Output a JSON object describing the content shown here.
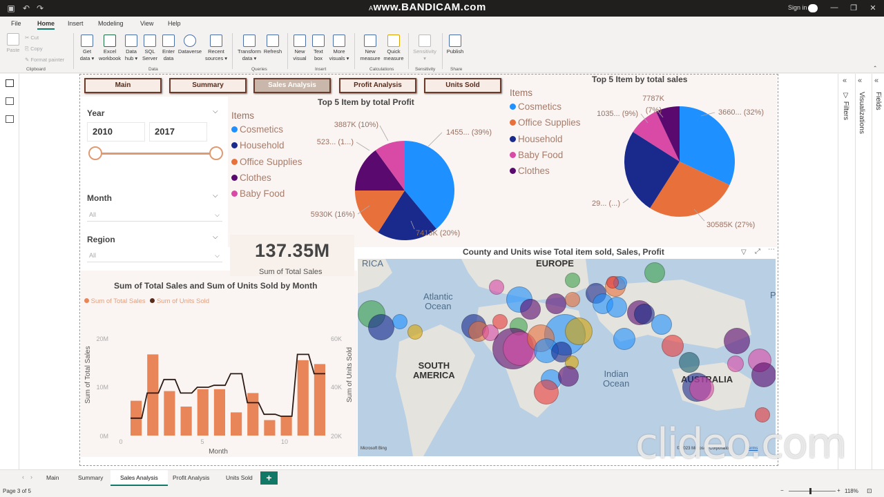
{
  "window": {
    "title": "www.BANDICAM.com",
    "title_prefix": "A",
    "signin": "Sign in"
  },
  "menu": [
    "File",
    "Home",
    "Insert",
    "Modeling",
    "View",
    "Help"
  ],
  "ribbon": {
    "clipboard": {
      "paste": "Paste",
      "cut": "Cut",
      "copy": "Copy",
      "format_painter": "Format painter",
      "group": "Clipboard"
    },
    "data": {
      "get_data": "Get\ndata ▾",
      "excel": "Excel\nworkbook",
      "data_hub": "Data\nhub ▾",
      "sql": "SQL\nServer",
      "enter": "Enter\ndata",
      "dataverse": "Dataverse",
      "recent": "Recent\nsources ▾",
      "group": "Data"
    },
    "queries": {
      "transform": "Transform\ndata ▾",
      "refresh": "Refresh",
      "group": "Queries"
    },
    "insert": {
      "new_visual": "New\nvisual",
      "text_box": "Text\nbox",
      "more": "More\nvisuals ▾",
      "group": "Insert"
    },
    "calc": {
      "new_measure": "New\nmeasure",
      "quick": "Quick\nmeasure",
      "group": "Calculations"
    },
    "sens": {
      "sensitivity": "Sensitivity\n▾",
      "group": "Sensitivity"
    },
    "share": {
      "publish": "Publish",
      "group": "Share"
    }
  },
  "nav": [
    "Main",
    "Summary",
    "Sales Analysis",
    "Profit Analysis",
    "Units Sold"
  ],
  "slicers": {
    "year": {
      "title": "Year",
      "from": "2010",
      "to": "2017"
    },
    "month": {
      "title": "Month",
      "value": "All"
    },
    "region": {
      "title": "Region",
      "value": "All"
    }
  },
  "legend_title": "Items",
  "profit_legend": [
    {
      "label": "Cosmetics",
      "color": "#1e90ff"
    },
    {
      "label": "Household",
      "color": "#1a2a8c"
    },
    {
      "label": "Office Supplies",
      "color": "#e8703a"
    },
    {
      "label": "Clothes",
      "color": "#5a0a6e"
    },
    {
      "label": "Baby Food",
      "color": "#d94aa6"
    }
  ],
  "sales_legend": [
    {
      "label": "Cosmetics",
      "color": "#1e90ff"
    },
    {
      "label": "Office Supplies",
      "color": "#e8703a"
    },
    {
      "label": "Household",
      "color": "#1a2a8c"
    },
    {
      "label": "Baby Food",
      "color": "#d94aa6"
    },
    {
      "label": "Clothes",
      "color": "#5a0a6e"
    }
  ],
  "profit_pie": {
    "title": "Top 5 Item by total Profit",
    "labels": [
      "1455... (39%)",
      "7413K (20%)",
      "5930K (16%)",
      "523... (1...)",
      "3887K (10%)"
    ]
  },
  "sales_pie": {
    "title": "Top 5 Item by total sales",
    "labels": [
      "3660... (32%)",
      "30585K (27%)",
      "29... (...)",
      "1035... (9%)",
      "7787K",
      "(7%)"
    ]
  },
  "kpi": {
    "value": "137.35M",
    "label": "Sum of Total Sales"
  },
  "combo": {
    "title": "Sum of Total Sales and Sum of Units Sold by Month",
    "legend": [
      "Sum of Total Sales",
      "Sum of Units Sold"
    ],
    "xlabel": "Month",
    "ylabel_left": "Sum of Total Sales",
    "ylabel_right": "Sum of Units Sold",
    "yticks_left": [
      "20M",
      "10M",
      "0M"
    ],
    "yticks_right": [
      "60K",
      "40K",
      "20K"
    ],
    "xticks": [
      "0",
      "5",
      "10"
    ]
  },
  "map": {
    "title": "County and Units wise Total item sold, Sales, Profit",
    "labels": [
      "RICA",
      "EUROPE",
      "Atlantic\nOcean",
      "SOUTH\nAMERICA",
      "Indian\nOcean",
      "AUSTRALIA",
      "P"
    ],
    "copyright": "© 2023 Microsoft Corporation",
    "terms": "Terms",
    "bing": "Microsoft Bing"
  },
  "page_tabs": [
    "Main",
    "Summary",
    "Sales Analysis",
    "Profit Analysis",
    "Units Sold"
  ],
  "panes": {
    "filters": "Filters",
    "visualizations": "Visualizations",
    "fields": "Fields"
  },
  "status": {
    "page": "Page 3 of 5",
    "zoom": "118%"
  },
  "watermark": "clideo.com",
  "chart_data": [
    {
      "type": "pie",
      "title": "Top 5 Item by total Profit",
      "categories": [
        "Cosmetics",
        "Household",
        "Office Supplies",
        "Clothes",
        "Baby Food"
      ],
      "values": [
        39,
        20,
        16,
        15,
        10
      ]
    },
    {
      "type": "pie",
      "title": "Top 5 Item by total sales",
      "categories": [
        "Cosmetics",
        "Office Supplies",
        "Household",
        "Baby Food",
        "Clothes"
      ],
      "values": [
        32,
        27,
        25,
        9,
        7
      ]
    },
    {
      "type": "bar",
      "title": "Sum of Total Sales and Sum of Units Sold by Month",
      "categories": [
        "1",
        "2",
        "3",
        "4",
        "5",
        "6",
        "7",
        "8",
        "9",
        "10",
        "11",
        "12"
      ],
      "series": [
        {
          "name": "Sum of Total Sales",
          "values": [
            9,
            21,
            11.5,
            7.5,
            12,
            12,
            6,
            11,
            4,
            5,
            19.5,
            18.5
          ]
        },
        {
          "name": "Sum of Units Sold",
          "values": [
            29,
            42,
            49,
            42,
            45,
            46,
            52,
            37,
            31,
            30,
            62,
            52
          ]
        }
      ],
      "xlabel": "Month",
      "ylabel": "Sum of Total Sales",
      "ylim": [
        0,
        25
      ],
      "ylim_right": [
        20,
        70
      ]
    }
  ]
}
